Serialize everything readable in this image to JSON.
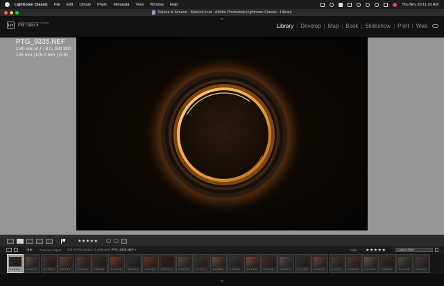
{
  "menubar": {
    "app_name": "Lightroom Classic",
    "items": [
      "File",
      "Edit",
      "Library",
      "Photo",
      "Metadata",
      "View",
      "Window",
      "Help"
    ],
    "status_icons": [
      "battery-icon",
      "bluetooth-icon",
      "font-icon",
      "grid-icon",
      "play-icon",
      "wifi-icon",
      "search-icon",
      "control-center-icon",
      "user-icon"
    ],
    "clock": "Thu Nov 20  11:10 AM"
  },
  "window": {
    "title": "Selena & Simeon - Married.lrcat - Adobe Photoshop Lightroom Classic - Library"
  },
  "identity": {
    "logo": "Lrc",
    "product": "Adobe Lightroom Classic",
    "user": "Phil Cates  ▾"
  },
  "modules": [
    "Library",
    "Develop",
    "Map",
    "Book",
    "Slideshow",
    "Print",
    "Web"
  ],
  "active_module": "Library",
  "photo_info": {
    "filename": "PTG_9335.NEF",
    "exposure": "1/40 sec at ƒ / 8.0, ISO 800",
    "lens": "105 mm (105.0 mm ƒ/2.8)"
  },
  "toolbar": {
    "rating": "★★★★★"
  },
  "filmstrip_header": {
    "pages": "1 2",
    "source_label": "Previous Import",
    "count_prefix": "129 of 875 photos / 1 selected /",
    "selected_file": "PTG_9335.NEF",
    "filter_label": "Filter :",
    "filter_stars": "★★★★★",
    "filter_select": "Custom Filter"
  },
  "filmstrip": {
    "thumb_rating": "★★★★★",
    "thumb_colors": [
      "#3a2a1a",
      "#5a4a3a",
      "#4a2f25",
      "#6a4030",
      "#5a3a2a",
      "#3d2d22",
      "#7a3a2a",
      "#2e2e2e",
      "#6a3525",
      "#3a1e14",
      "#5a4535",
      "#4a3020",
      "#6b4a3a",
      "#3a3a2a",
      "#7a4535",
      "#4a2a1a",
      "#5a4a4a",
      "#3a2a2a",
      "#6a4535",
      "#4a3a2a",
      "#5a3525",
      "#6a5040",
      "#3a2a20",
      "#5a4a3a",
      "#4a3a30"
    ],
    "selected_index": 0
  }
}
